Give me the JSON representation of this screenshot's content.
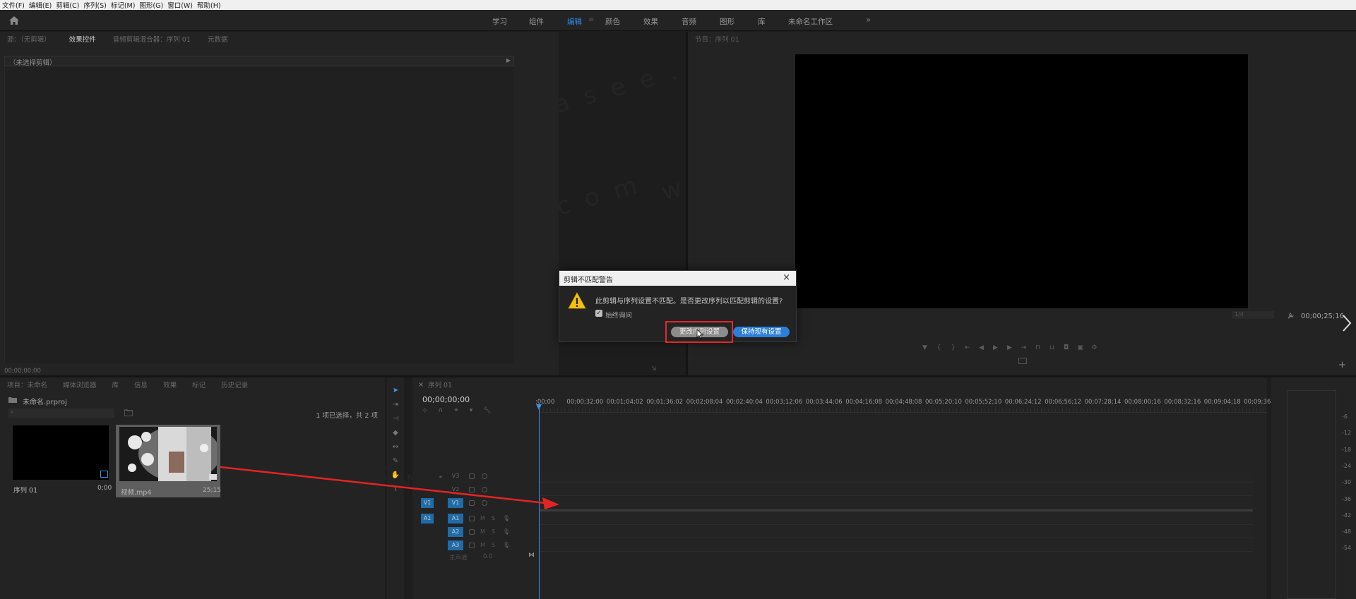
{
  "menubar": [
    "文件(F)",
    "编辑(E)",
    "剪辑(C)",
    "序列(S)",
    "标记(M)",
    "图形(G)",
    "窗口(W)",
    "帮助(H)"
  ],
  "workspaces": {
    "items": [
      "学习",
      "组件",
      "编辑",
      "颜色",
      "效果",
      "音频",
      "图形",
      "库",
      "未命名工作区"
    ],
    "active": "编辑",
    "more": "»"
  },
  "source": {
    "tabs": [
      "源：（无剪辑）",
      "效果控件",
      "音频剪辑混合器：序列 01",
      "元数据"
    ],
    "no_clip": "（未选择剪辑）",
    "timecode": "00;00;00;00"
  },
  "program": {
    "tab": "节目：序列 01",
    "timecode": "00;00;25;16",
    "fit": "1/4"
  },
  "project": {
    "tabs": [
      "项目：未命名",
      "媒体浏览器",
      "库",
      "信息",
      "效果",
      "标记",
      "历史记录"
    ],
    "file": "未命名.prproj",
    "count": "1 项已选择，共 2 项",
    "clips": [
      {
        "name": "序列 01",
        "duration": "0;00"
      },
      {
        "name": "视频.mp4",
        "duration": "25;15"
      }
    ]
  },
  "timeline": {
    "tab": "序列 01",
    "timecode": "00;00;00;00",
    "ruler": [
      ":00;00",
      "00;00;32;00",
      "00;01;04;02",
      "00;01;36;02",
      "00;02;08;04",
      "00;02;40;04",
      "00;03;12;06",
      "00;03;44;06",
      "00;04;16;08",
      "00;04;48;08",
      "00;05;20;10",
      "00;05;52;10",
      "00;06;24;12",
      "00;06;56;12",
      "00;07;28;14",
      "00;08;00;16",
      "00;08;32;16",
      "00;09;04;18",
      "00;09;36;18"
    ],
    "video_tracks": [
      "V3",
      "V2",
      "V1"
    ],
    "audio_tracks": [
      "A1",
      "A2",
      "A3"
    ],
    "src_video": "V1",
    "src_audio": "A1",
    "master": "主声道",
    "master_value": "0.0"
  },
  "meter": {
    "scale": [
      "-6",
      "-12",
      "-18",
      "-24",
      "-30",
      "-36",
      "-42",
      "-48",
      "-54"
    ]
  },
  "dialog": {
    "title": "剪辑不匹配警告",
    "message": "此剪辑与序列设置不匹配。是否更改序列以匹配剪辑的设置?",
    "always_ask": "始终询问",
    "always_ask_checked": true,
    "change_button": "更改序列设置",
    "keep_button": "保持现有设置"
  },
  "watermark": "wasee.com",
  "colors": {
    "accent": "#2d8ceb",
    "highlight": "#e5282b",
    "track_target": "#1f6ca8"
  }
}
